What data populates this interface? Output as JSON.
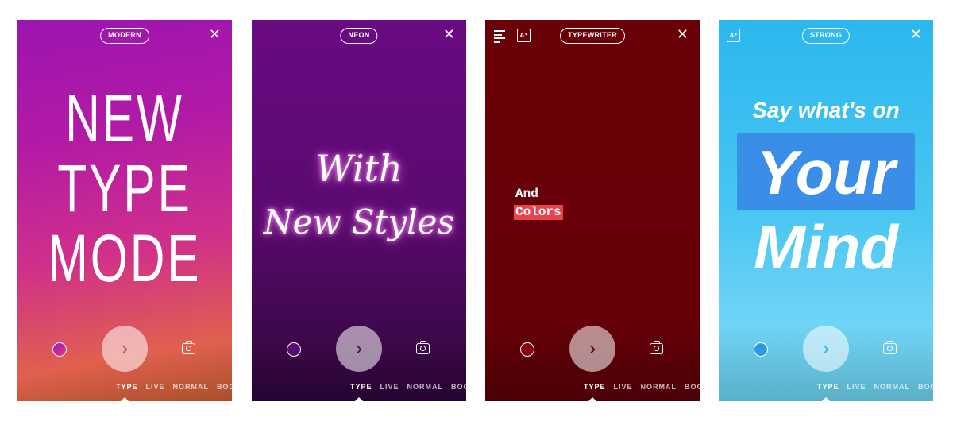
{
  "modes": [
    "TYPE",
    "LIVE",
    "NORMAL",
    "BOOI"
  ],
  "close_icon": "close-icon",
  "shutter_glyph": "›",
  "panels": [
    {
      "style": "MODERN",
      "lines": [
        "NEW",
        "TYPE",
        "MODE"
      ]
    },
    {
      "style": "NEON",
      "lines": [
        "With",
        "New Styles"
      ]
    },
    {
      "style": "TYPEWRITER",
      "lines": [
        "And",
        "Colors"
      ],
      "highlight_color": "#e8434f"
    },
    {
      "style": "STRONG",
      "lines": [
        "Say what's on",
        "Your",
        "Mind"
      ],
      "highlight_color": "#3a8ee8"
    }
  ],
  "aa_label": "A⁺"
}
